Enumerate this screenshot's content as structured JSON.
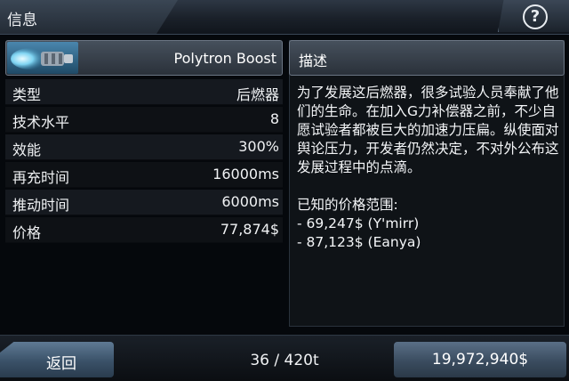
{
  "header": {
    "title": "信息",
    "help_icon": "question-icon",
    "help_glyph": "?"
  },
  "item": {
    "name": "Polytron Boost",
    "thumbnail_icon": "afterburner-thruster-icon"
  },
  "stats": [
    {
      "label": "类型",
      "value": "后燃器"
    },
    {
      "label": "技术水平",
      "value": "8"
    },
    {
      "label": "效能",
      "value": "300%"
    },
    {
      "label": "再充时间",
      "value": "16000ms"
    },
    {
      "label": "推动时间",
      "value": "6000ms"
    },
    {
      "label": "价格",
      "value": "77,874$"
    }
  ],
  "description": {
    "title": "描述",
    "text": "为了发展这后燃器，很多试验人员奉献了他们的生命。在加入G力补偿器之前，不少自愿试验者都被巨大的加速力压扁。纵使面对舆论压力，开发者仍然决定，不对外公布这发展过程中的点滴。\n\n已知的价格范围:\n- 69,247$ (Y'mirr)\n- 87,123$ (Eanya)"
  },
  "footer": {
    "back_label": "返回",
    "cargo": "36 / 420t",
    "money": "19,972,940$"
  },
  "colors": {
    "accent_blue": "#4a86ad",
    "panel_dark": "#0f1317"
  }
}
